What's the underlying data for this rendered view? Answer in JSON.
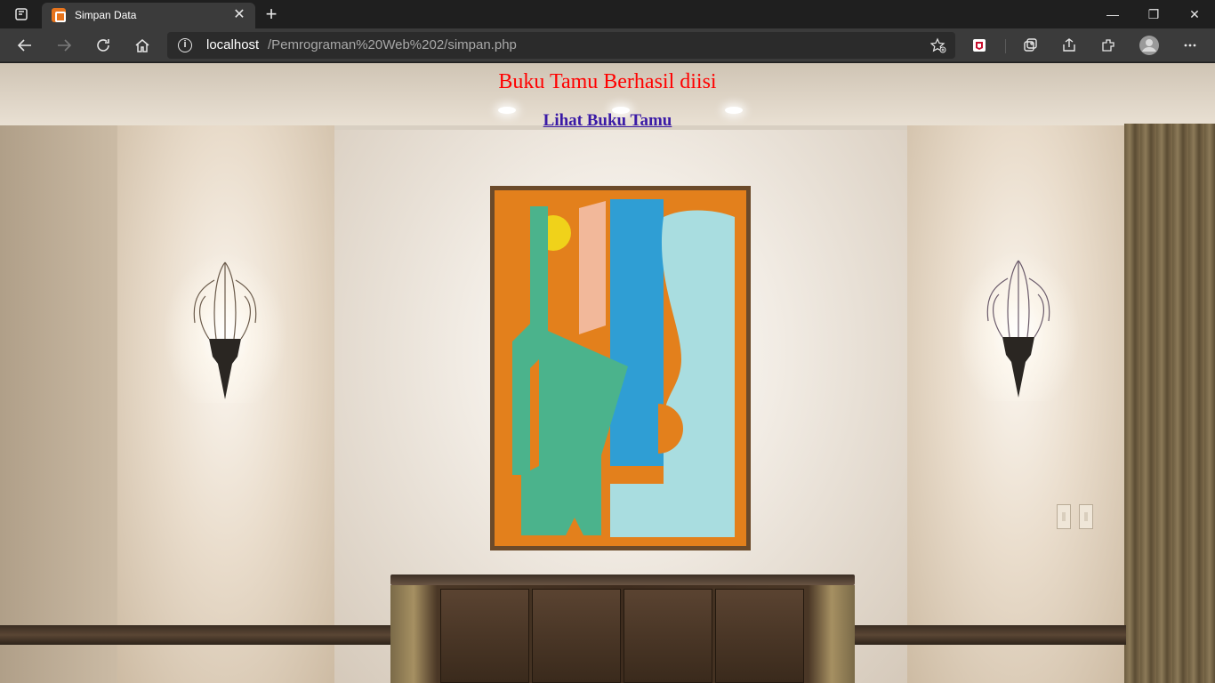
{
  "browser": {
    "tab_title": "Simpan Data",
    "url_host": "localhost",
    "url_path": "/Pemrograman%20Web%202/simpan.php",
    "icons": {
      "tab_actions": "tab-actions-icon",
      "favicon": "xampp-favicon",
      "close_tab": "close-icon",
      "new_tab": "plus-icon",
      "back": "arrow-left-icon",
      "forward": "arrow-right-icon",
      "refresh": "refresh-icon",
      "home": "home-icon",
      "site_info": "info-icon",
      "favorites": "star-add-icon",
      "extension": "extension-icon",
      "collections": "collections-icon",
      "share": "share-icon",
      "extensions_menu": "puzzle-icon",
      "profile": "profile-avatar",
      "menu": "more-icon"
    }
  },
  "page": {
    "message": "Buku Tamu Berhasil diisi",
    "link_label": "Lihat Buku Tamu",
    "message_color": "#ff0000",
    "link_color": "#3a1aa6"
  }
}
